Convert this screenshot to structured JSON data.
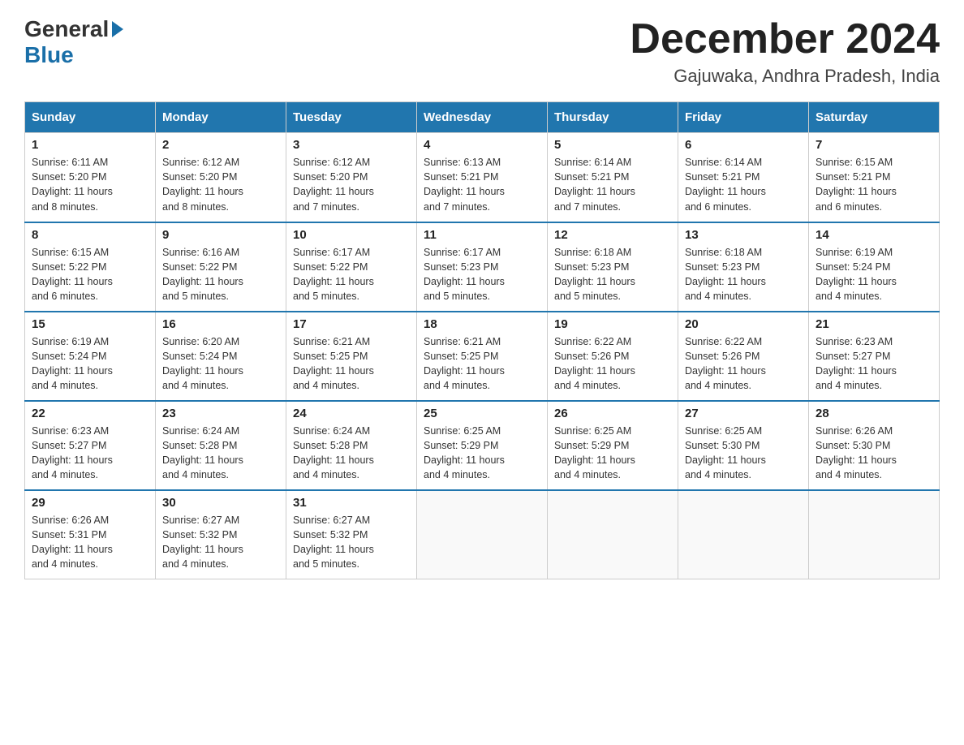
{
  "header": {
    "logo_general": "General",
    "logo_blue": "Blue",
    "month_title": "December 2024",
    "location": "Gajuwaka, Andhra Pradesh, India"
  },
  "days_of_week": [
    "Sunday",
    "Monday",
    "Tuesday",
    "Wednesday",
    "Thursday",
    "Friday",
    "Saturday"
  ],
  "weeks": [
    [
      {
        "day": "1",
        "sunrise": "6:11 AM",
        "sunset": "5:20 PM",
        "daylight": "11 hours and 8 minutes."
      },
      {
        "day": "2",
        "sunrise": "6:12 AM",
        "sunset": "5:20 PM",
        "daylight": "11 hours and 8 minutes."
      },
      {
        "day": "3",
        "sunrise": "6:12 AM",
        "sunset": "5:20 PM",
        "daylight": "11 hours and 7 minutes."
      },
      {
        "day": "4",
        "sunrise": "6:13 AM",
        "sunset": "5:21 PM",
        "daylight": "11 hours and 7 minutes."
      },
      {
        "day": "5",
        "sunrise": "6:14 AM",
        "sunset": "5:21 PM",
        "daylight": "11 hours and 7 minutes."
      },
      {
        "day": "6",
        "sunrise": "6:14 AM",
        "sunset": "5:21 PM",
        "daylight": "11 hours and 6 minutes."
      },
      {
        "day": "7",
        "sunrise": "6:15 AM",
        "sunset": "5:21 PM",
        "daylight": "11 hours and 6 minutes."
      }
    ],
    [
      {
        "day": "8",
        "sunrise": "6:15 AM",
        "sunset": "5:22 PM",
        "daylight": "11 hours and 6 minutes."
      },
      {
        "day": "9",
        "sunrise": "6:16 AM",
        "sunset": "5:22 PM",
        "daylight": "11 hours and 5 minutes."
      },
      {
        "day": "10",
        "sunrise": "6:17 AM",
        "sunset": "5:22 PM",
        "daylight": "11 hours and 5 minutes."
      },
      {
        "day": "11",
        "sunrise": "6:17 AM",
        "sunset": "5:23 PM",
        "daylight": "11 hours and 5 minutes."
      },
      {
        "day": "12",
        "sunrise": "6:18 AM",
        "sunset": "5:23 PM",
        "daylight": "11 hours and 5 minutes."
      },
      {
        "day": "13",
        "sunrise": "6:18 AM",
        "sunset": "5:23 PM",
        "daylight": "11 hours and 4 minutes."
      },
      {
        "day": "14",
        "sunrise": "6:19 AM",
        "sunset": "5:24 PM",
        "daylight": "11 hours and 4 minutes."
      }
    ],
    [
      {
        "day": "15",
        "sunrise": "6:19 AM",
        "sunset": "5:24 PM",
        "daylight": "11 hours and 4 minutes."
      },
      {
        "day": "16",
        "sunrise": "6:20 AM",
        "sunset": "5:24 PM",
        "daylight": "11 hours and 4 minutes."
      },
      {
        "day": "17",
        "sunrise": "6:21 AM",
        "sunset": "5:25 PM",
        "daylight": "11 hours and 4 minutes."
      },
      {
        "day": "18",
        "sunrise": "6:21 AM",
        "sunset": "5:25 PM",
        "daylight": "11 hours and 4 minutes."
      },
      {
        "day": "19",
        "sunrise": "6:22 AM",
        "sunset": "5:26 PM",
        "daylight": "11 hours and 4 minutes."
      },
      {
        "day": "20",
        "sunrise": "6:22 AM",
        "sunset": "5:26 PM",
        "daylight": "11 hours and 4 minutes."
      },
      {
        "day": "21",
        "sunrise": "6:23 AM",
        "sunset": "5:27 PM",
        "daylight": "11 hours and 4 minutes."
      }
    ],
    [
      {
        "day": "22",
        "sunrise": "6:23 AM",
        "sunset": "5:27 PM",
        "daylight": "11 hours and 4 minutes."
      },
      {
        "day": "23",
        "sunrise": "6:24 AM",
        "sunset": "5:28 PM",
        "daylight": "11 hours and 4 minutes."
      },
      {
        "day": "24",
        "sunrise": "6:24 AM",
        "sunset": "5:28 PM",
        "daylight": "11 hours and 4 minutes."
      },
      {
        "day": "25",
        "sunrise": "6:25 AM",
        "sunset": "5:29 PM",
        "daylight": "11 hours and 4 minutes."
      },
      {
        "day": "26",
        "sunrise": "6:25 AM",
        "sunset": "5:29 PM",
        "daylight": "11 hours and 4 minutes."
      },
      {
        "day": "27",
        "sunrise": "6:25 AM",
        "sunset": "5:30 PM",
        "daylight": "11 hours and 4 minutes."
      },
      {
        "day": "28",
        "sunrise": "6:26 AM",
        "sunset": "5:30 PM",
        "daylight": "11 hours and 4 minutes."
      }
    ],
    [
      {
        "day": "29",
        "sunrise": "6:26 AM",
        "sunset": "5:31 PM",
        "daylight": "11 hours and 4 minutes."
      },
      {
        "day": "30",
        "sunrise": "6:27 AM",
        "sunset": "5:32 PM",
        "daylight": "11 hours and 4 minutes."
      },
      {
        "day": "31",
        "sunrise": "6:27 AM",
        "sunset": "5:32 PM",
        "daylight": "11 hours and 5 minutes."
      },
      null,
      null,
      null,
      null
    ]
  ],
  "labels": {
    "sunrise": "Sunrise:",
    "sunset": "Sunset:",
    "daylight": "Daylight:"
  }
}
